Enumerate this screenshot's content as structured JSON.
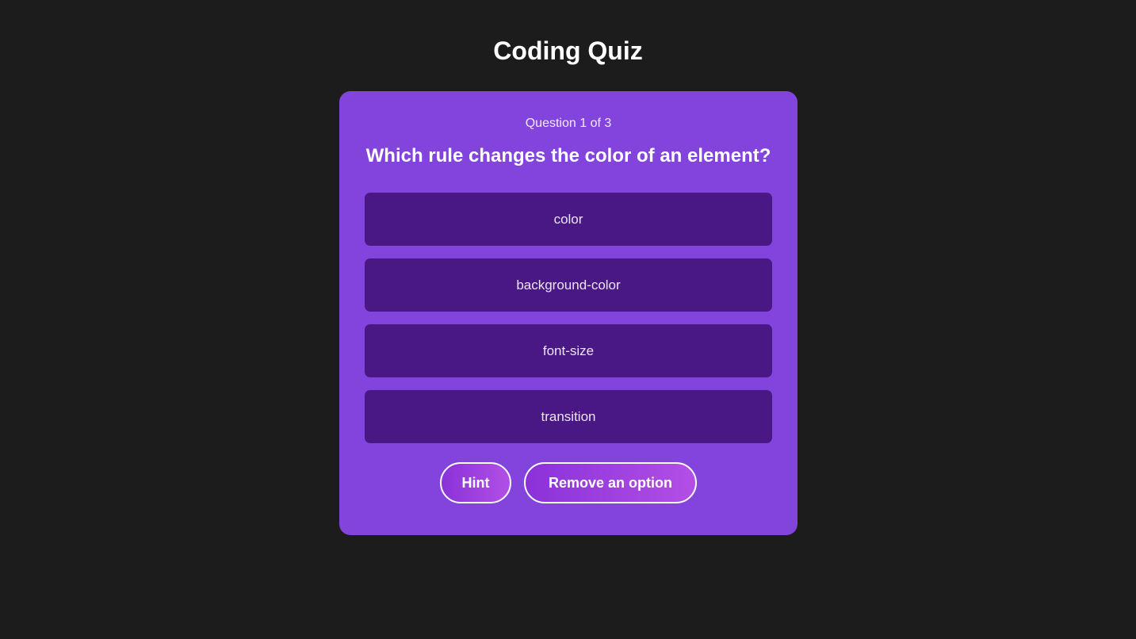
{
  "header": {
    "title": "Coding Quiz"
  },
  "quiz": {
    "counter": {
      "prefix": "Question",
      "current": "1",
      "separator": "of",
      "total": "3"
    },
    "question": "Which rule changes the color of an element?",
    "options": [
      {
        "label": "color"
      },
      {
        "label": "background-color"
      },
      {
        "label": "font-size"
      },
      {
        "label": "transition"
      }
    ],
    "actions": {
      "hint_label": "Hint",
      "remove_label": "Remove an option"
    }
  },
  "colors": {
    "page_background": "#1c1c1c",
    "card_background": "#8344dd",
    "option_background": "#4a1884",
    "button_gradient_start": "#8a32d9",
    "button_gradient_end": "#b24fe6",
    "text": "#ffffff"
  }
}
